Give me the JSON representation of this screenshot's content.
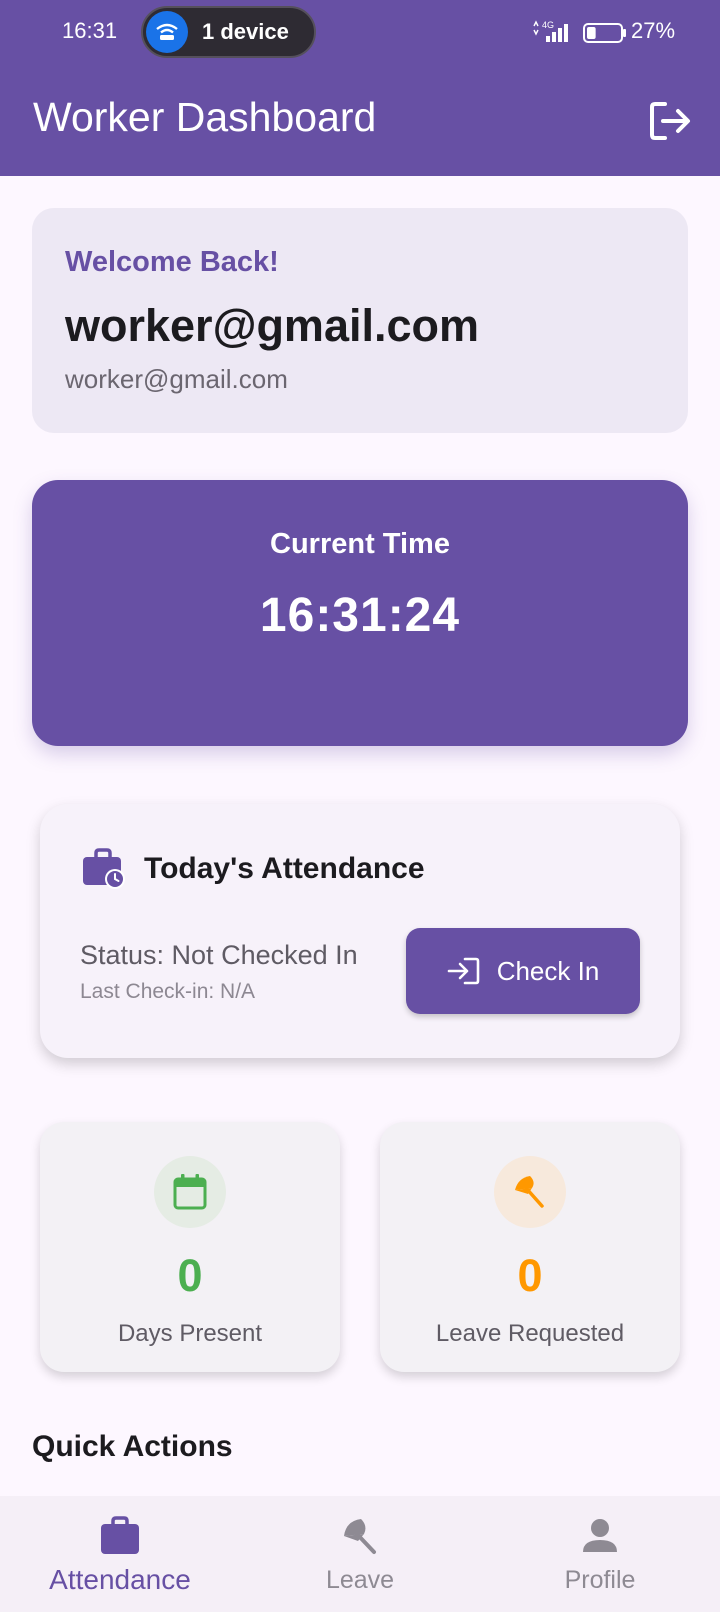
{
  "status_bar": {
    "time": "16:31",
    "hotspot_label": "1 device",
    "network": "4G",
    "battery_percent": "27%",
    "battery_level": 0.27
  },
  "app_bar": {
    "title": "Worker Dashboard",
    "logout_icon": "logout-icon"
  },
  "welcome": {
    "greeting": "Welcome Back!",
    "name": "worker@gmail.com",
    "email": "worker@gmail.com"
  },
  "clock": {
    "label": "Current Time",
    "value": "16:31:24"
  },
  "attendance": {
    "title": "Today's Attendance",
    "status": "Status: Not Checked In",
    "last_checkin": "Last Check-in: N/A",
    "button_label": "Check In",
    "icon": "briefcase-clock-icon"
  },
  "stats": [
    {
      "value": "0",
      "label": "Days Present",
      "color": "#4caf50",
      "icon": "calendar-icon"
    },
    {
      "value": "0",
      "label": "Leave Requested",
      "color": "#ff9800",
      "icon": "beach-umbrella-icon"
    }
  ],
  "quick_actions": {
    "title": "Quick Actions"
  },
  "bottom_nav": {
    "items": [
      {
        "label": "Attendance",
        "icon": "briefcase-icon",
        "active": true
      },
      {
        "label": "Leave",
        "icon": "beach-umbrella-icon",
        "active": false
      },
      {
        "label": "Profile",
        "icon": "person-icon",
        "active": false
      }
    ]
  },
  "colors": {
    "primary": "#6750a4",
    "success": "#4caf50",
    "warning": "#ff9800"
  }
}
